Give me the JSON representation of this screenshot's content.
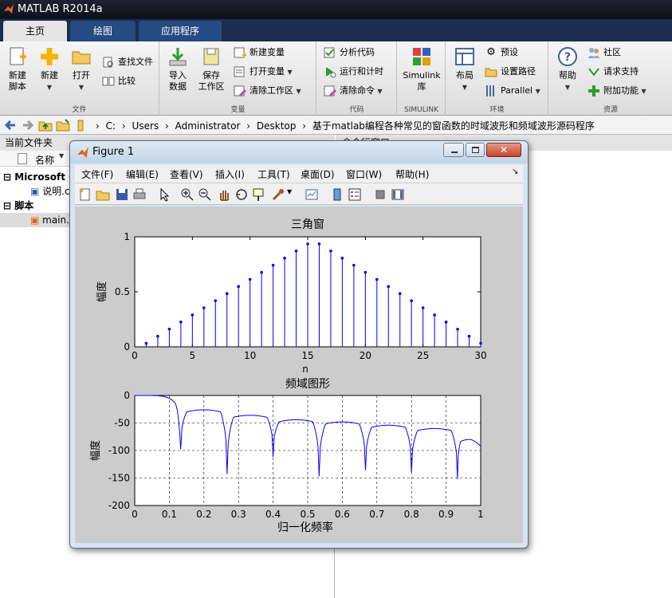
{
  "app": {
    "title": "MATLAB R2014a"
  },
  "tabs": [
    "主页",
    "绘图",
    "应用程序"
  ],
  "ribbon": {
    "file": {
      "caption": "文件",
      "new_script": "新建\n脚本",
      "new": "新建",
      "open": "打开",
      "find_files": "查找文件",
      "compare": "比较"
    },
    "variable": {
      "caption": "变量",
      "import": "导入\n数据",
      "save_ws": "保存\n工作区",
      "new_var": "新建变量",
      "open_var": "打开变量",
      "clear_ws": "清除工作区"
    },
    "code": {
      "caption": "代码",
      "analyze": "分析代码",
      "run_time": "运行和计时",
      "clear_cmd": "清除命令"
    },
    "simulink": {
      "caption": "SIMULINK",
      "lib": "Simulink\n库"
    },
    "env": {
      "caption": "环境",
      "layout": "布局",
      "prefs": "预设",
      "set_path": "设置路径",
      "parallel": "Parallel"
    },
    "resources": {
      "caption": "资源",
      "help": "帮助",
      "community": "社区",
      "support": "请求支持",
      "addons": "附加功能"
    }
  },
  "address": [
    "C:",
    "Users",
    "Administrator",
    "Desktop",
    "基于matlab编程各种常见的窗函数的时域波形和频域波形源码程序"
  ],
  "left_pane": {
    "title": "当前文件夹",
    "col_name": "名称",
    "group1": "Microsoft O",
    "file1": "说明.c",
    "group2": "脚本",
    "file2": "main."
  },
  "right_pane": {
    "title": "命令行窗口"
  },
  "figure": {
    "title": "Figure 1",
    "menu": [
      "文件(F)",
      "编辑(E)",
      "查看(V)",
      "插入(I)",
      "工具(T)",
      "桌面(D)",
      "窗口(W)",
      "帮助(H)"
    ]
  },
  "chart_data": [
    {
      "type": "stem",
      "title": "三角窗",
      "xlabel": "n",
      "ylabel": "幅度",
      "xlim": [
        0,
        30
      ],
      "ylim": [
        0,
        1
      ],
      "xticks": [
        0,
        5,
        10,
        15,
        20,
        25,
        30
      ],
      "yticks": [
        0,
        0.5,
        1
      ],
      "x": [
        1,
        2,
        3,
        4,
        5,
        6,
        7,
        8,
        9,
        10,
        11,
        12,
        13,
        14,
        15,
        16,
        17,
        18,
        19,
        20,
        21,
        22,
        23,
        24,
        25,
        26,
        27,
        28,
        29,
        30
      ],
      "values": [
        0.0323,
        0.0968,
        0.1613,
        0.2258,
        0.2903,
        0.3548,
        0.4194,
        0.4839,
        0.5484,
        0.6129,
        0.6774,
        0.7419,
        0.8065,
        0.871,
        0.9355,
        0.9355,
        0.871,
        0.8065,
        0.7419,
        0.6774,
        0.6129,
        0.5484,
        0.4839,
        0.4194,
        0.3548,
        0.2903,
        0.2258,
        0.1613,
        0.0968,
        0.0323
      ],
      "grid": false,
      "color": "#0000ff"
    },
    {
      "type": "line",
      "title": "频域图形",
      "xlabel": "归一化频率",
      "ylabel": "幅度",
      "xlim": [
        0,
        1
      ],
      "ylim": [
        -200,
        0
      ],
      "xticks": [
        0,
        0.1,
        0.2,
        0.3,
        0.4,
        0.5,
        0.6,
        0.7,
        0.8,
        0.9,
        1
      ],
      "yticks": [
        0,
        -50,
        -100,
        -150,
        -200
      ],
      "nulls": [
        0.133,
        0.267,
        0.4,
        0.533,
        0.667,
        0.8,
        0.933
      ],
      "null_depths": [
        -98,
        -143,
        -112,
        -147,
        -136,
        -140,
        -152
      ],
      "lobe_peaks": [
        -26,
        -36,
        -44,
        -48,
        -54,
        -60,
        -80
      ],
      "grid": true,
      "color": "#0000ff"
    }
  ]
}
